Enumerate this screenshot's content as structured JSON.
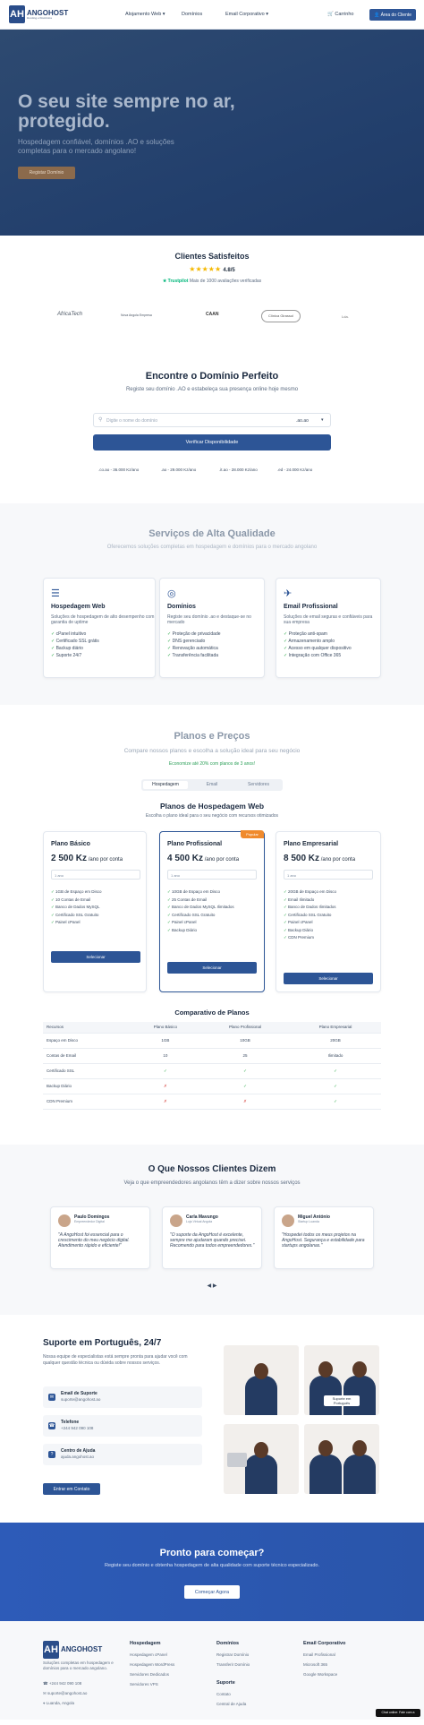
{
  "nav": {
    "brand": "ANGOHOST",
    "brand_sub": "Hosting e Domínios",
    "items": [
      "Alojamento Web ▾",
      "Domínios",
      "Email Corporativo ▾"
    ],
    "cart": "🛒 Carrinho",
    "client_btn": "👤 Área do Cliente"
  },
  "hero": {
    "title": "O seu site sempre no ar, protegido.",
    "subtitle": "Hospedagem confiável, domínios .AO e soluções completas para o mercado angolano!",
    "button": "Registar Domínio"
  },
  "clients": {
    "title": "Clientes Satisfeitos",
    "stars": "★★★★★",
    "rating": "4.8/5",
    "trustpilot": "★ Trustpilot",
    "reviews": "Mais de 1000 avaliações verificadas",
    "logos": [
      "AfricaTech",
      "Nova Angola Empresa",
      "CAAN",
      "Clínica Girassol",
      "Lda."
    ]
  },
  "domain": {
    "title": "Encontre o Domínio Perfeito",
    "subtitle": "Registe seu domínio .AO e estabeleça sua presença online hoje mesmo",
    "placeholder": "Digite o nome do domínio",
    "tld": ".ao.ao",
    "button": "Verificar Disponibilidade",
    "prices": [
      ".co.ao - 36.000 Kz/ano",
      ".ao - 29.000 Kz/ano",
      ".it.ao - 28.000 Kz/ano",
      ".ed - 24.000 Kz/ano"
    ]
  },
  "services": {
    "title": "Serviços de Alta Qualidade",
    "subtitle": "Oferecemos soluções completas em hospedagem e domínios para o mercado angolano",
    "cards": [
      {
        "icon": "☰",
        "title": "Hospedagem Web",
        "desc": "Soluções de hospedagem de alto desempenho com garantia de uptime",
        "items": [
          "cPanel intuitivo",
          "Certificado SSL grátis",
          "Backup diário",
          "Suporte 24/7"
        ]
      },
      {
        "icon": "◎",
        "title": "Domínios",
        "desc": "Registe seu domínio .ao e destaque-se no mercado",
        "items": [
          "Proteção de privacidade",
          "DNS gerenciado",
          "Renovação automática",
          "Transferência facilitada"
        ]
      },
      {
        "icon": "✈",
        "title": "Email Profissional",
        "desc": "Soluções de email seguras e confiáveis para sua empresa",
        "items": [
          "Proteção anti-spam",
          "Armazenamento amplo",
          "Acesso em qualquer dispositivo",
          "Integração com Office 365"
        ]
      }
    ]
  },
  "plans": {
    "title": "Planos e Preços",
    "subtitle": "Compare nossos planos e escolha a solução ideal para seu negócio",
    "saving": "Economize até 20% com planos de 3 anos!",
    "tabs": [
      "Hospedagem",
      "Email",
      "Servidores"
    ],
    "heading": "Planos de Hospedagem Web",
    "heading_sub": "Escolha o plano ideal para o seu negócio com recursos otimizados",
    "cards": [
      {
        "name": "Plano Básico",
        "price": "2 500 Kz",
        "period": " /ano por conta",
        "select": "1 ano",
        "feats": [
          "1GB de Espaço em Disco",
          "10 Contas de Email",
          "Banco de Dados MySQL",
          "Certificado SSL Gratuito",
          "Painel cPanel"
        ],
        "no": [],
        "button": "Selecionar"
      },
      {
        "name": "Plano Profissional",
        "badge": "Popular",
        "price": "4 500 Kz",
        "period": " /ano por conta",
        "select": "1 ano",
        "feats": [
          "10GB de Espaço em Disco",
          "25 Contas de Email",
          "Banco de Dados MySQL Ilimitados",
          "Certificado SSL Gratuito",
          "Painel cPanel",
          "Backup Diário"
        ],
        "no": [],
        "button": "Selecionar"
      },
      {
        "name": "Plano Empresarial",
        "price": "8 500 Kz",
        "period": " /ano por conta",
        "select": "1 ano",
        "feats": [
          "20GB de Espaço em Disco",
          "Email Ilimitado",
          "Banco de Dados Ilimitados",
          "Certificado SSL Gratuito",
          "Painel cPanel",
          "Backup Diário",
          "CDN Premium"
        ],
        "no": [],
        "button": "Selecionar"
      }
    ]
  },
  "compare": {
    "title": "Comparativo de Planos",
    "head": [
      "Recursos",
      "Plano Básico",
      "Plano Profissional",
      "Plano Empresarial"
    ],
    "rows": [
      [
        "Espaço em Disco",
        "1GB",
        "10GB",
        "20GB"
      ],
      [
        "Contas de Email",
        "10",
        "25",
        "Ilimitado"
      ],
      [
        "Certificado SSL",
        "✓",
        "✓",
        "✓"
      ],
      [
        "Backup Diário",
        "✗",
        "✓",
        "✓"
      ],
      [
        "CDN Premium",
        "✗",
        "✗",
        "✓"
      ]
    ]
  },
  "testimonials": {
    "title": "O Que Nossos Clientes Dizem",
    "subtitle": "Veja o que empreendedores angolanos têm a dizer sobre nossos serviços",
    "items": [
      {
        "name": "Paulo Domingos",
        "role": "Empreendedor Digital",
        "quote": "\"A AngoHost foi essencial para o crescimento do meu negócio digital. Atendimento rápido e eficiente!\""
      },
      {
        "name": "Carla Mavungo",
        "role": "Loja Virtual Angola",
        "quote": "\"O suporte da AngoHost é excelente, sempre me ajudaram quando precisei. Recomendo para todos empreendedores.\""
      },
      {
        "name": "Miguel António",
        "role": "Startup Luanda",
        "quote": "\"Hospedei todos os meus projetos na AngoHost. Segurança e estabilidade para startups angolanas.\""
      }
    ],
    "arrows": "◀   ▶"
  },
  "support": {
    "title": "Suporte em Português, 24/7",
    "desc": "Nossa equipe de especialistas está sempre pronta para ajudar você com qualquer questão técnica ou dúvida sobre nossos serviços.",
    "boxes": [
      {
        "icon": "✉",
        "title": "Email de Suporte",
        "value": "suporte@angohost.ao"
      },
      {
        "icon": "☎",
        "title": "Telefone",
        "value": "+244 942 090 108"
      },
      {
        "icon": "?",
        "title": "Centro de Ajuda",
        "value": "ajuda.angohost.ao"
      }
    ],
    "button": "Entrar em Contato",
    "badge": "Suporte em Português"
  },
  "cta": {
    "title": "Pronto para começar?",
    "subtitle": "Registe seu domínio e obtenha hospedagem de alta qualidade com suporte técnico especializado.",
    "button": "Começar Agora"
  },
  "footer": {
    "about": "Soluções completas em hospedagem e domínios para o mercado angolano.",
    "phone": "☎ +244 942 090 108",
    "email": "✉ suporte@angohost.ao",
    "address": "⌖ Luanda, Angola",
    "cols": [
      {
        "title": "Hospedagem",
        "items": [
          "Hospedagem cPanel",
          "Hospedagem WordPress",
          "Servidores Dedicados",
          "Servidores VPS"
        ]
      },
      {
        "title": "Domínios",
        "items": [
          "Registrar Domínio",
          "Transferir Domínio"
        ]
      },
      {
        "title": "Email Corporativo",
        "items": [
          "Email Profissional",
          "Microsoft 365",
          "Google Workspace"
        ]
      }
    ],
    "col2b": {
      "title": "Suporte",
      "items": [
        "Contato",
        "Central de Ajuda"
      ]
    },
    "chat": "Chat online: Fale com a AngoHost"
  },
  "colors": {
    "primary": "#2d5596",
    "hero": "#23406d",
    "accent": "#8b6a4c",
    "cta": "#2d5bb8"
  }
}
